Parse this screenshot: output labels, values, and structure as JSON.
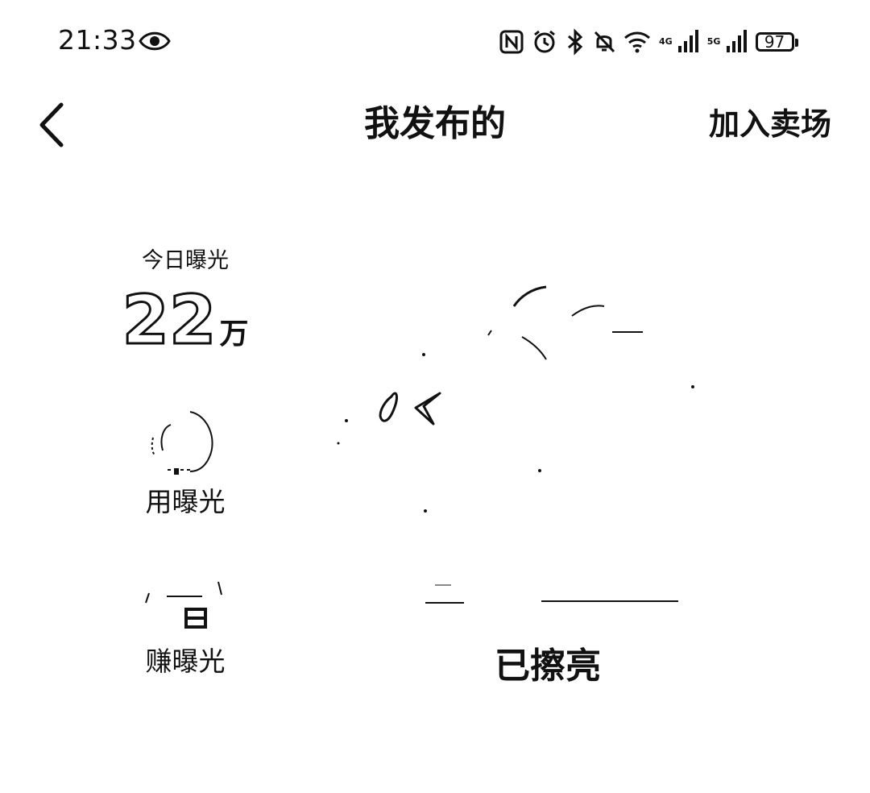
{
  "status_bar": {
    "time": "21:33",
    "eye_icon": "eye-icon",
    "icons": [
      "nfc-icon",
      "alarm-icon",
      "bluetooth-icon",
      "mute-icon",
      "wifi-icon",
      "signal-4g-icon",
      "signal-5g-icon"
    ],
    "net_4g": "4G",
    "net_5g": "5G",
    "battery": "97"
  },
  "header": {
    "back_icon": "chevron-left-icon",
    "title": "我发布的",
    "action": "加入卖场"
  },
  "stats": {
    "today_label": "今日曝光",
    "today_value": "22",
    "today_unit": "万",
    "use_label": "用曝光",
    "earn_label": "赚曝光"
  },
  "illustration": {
    "status": "已擦亮"
  }
}
